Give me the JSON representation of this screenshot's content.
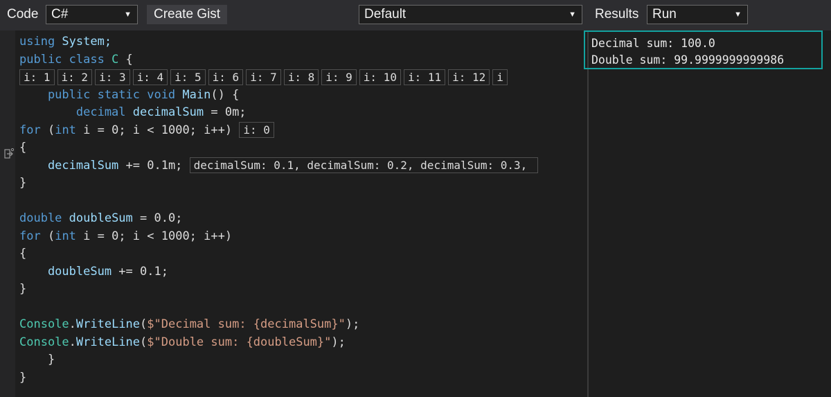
{
  "toolbar": {
    "code_label": "Code",
    "language": "C#",
    "create_gist": "Create Gist",
    "theme": "Default",
    "results_label": "Results",
    "run_mode": "Run"
  },
  "code_lines": [
    [
      {
        "t": "using ",
        "c": "kw"
      },
      {
        "t": "System;",
        "c": "id"
      }
    ],
    [
      {
        "t": "public class ",
        "c": "kw"
      },
      {
        "t": "C",
        "c": "ty"
      },
      {
        "t": " {",
        "c": "pl"
      }
    ],
    [
      {
        "b": "i: 1"
      },
      {
        "b": "i: 2"
      },
      {
        "b": "i: 3"
      },
      {
        "b": "i: 4"
      },
      {
        "b": "i: 5"
      },
      {
        "b": "i: 6"
      },
      {
        "b": "i: 7"
      },
      {
        "b": "i: 8"
      },
      {
        "b": "i: 9"
      },
      {
        "b": "i: 10"
      },
      {
        "b": "i: 11"
      },
      {
        "b": "i: 12"
      },
      {
        "b": "i"
      }
    ],
    [
      {
        "t": "    public static void ",
        "c": "kw"
      },
      {
        "t": "Main",
        "c": "id"
      },
      {
        "t": "() {",
        "c": "pl"
      }
    ],
    [
      {
        "t": "        decimal ",
        "c": "kw"
      },
      {
        "t": "decimalSum",
        "c": "id"
      },
      {
        "t": " = 0m;",
        "c": "pl"
      }
    ],
    [
      {
        "t": "for ",
        "c": "kw"
      },
      {
        "t": "(",
        "c": "pl"
      },
      {
        "t": "int",
        "c": "kw"
      },
      {
        "t": " i = 0; i < 1000; i++) ",
        "c": "pl"
      },
      {
        "b": "i: 0"
      }
    ],
    [
      {
        "t": "{",
        "c": "pl"
      }
    ],
    [
      {
        "t": "    decimalSum",
        "c": "id"
      },
      {
        "t": " += 0.1m; ",
        "c": "pl"
      },
      {
        "b": "decimalSum: 0.1, decimalSum: 0.2, decimalSum: 0.3, "
      }
    ],
    [
      {
        "t": "}",
        "c": "pl"
      }
    ],
    [
      {
        "t": "",
        "c": "pl"
      }
    ],
    [
      {
        "t": "double ",
        "c": "kw"
      },
      {
        "t": "doubleSum",
        "c": "id"
      },
      {
        "t": " = 0.0;",
        "c": "pl"
      }
    ],
    [
      {
        "t": "for ",
        "c": "kw"
      },
      {
        "t": "(",
        "c": "pl"
      },
      {
        "t": "int",
        "c": "kw"
      },
      {
        "t": " i = 0; i < 1000; i++)",
        "c": "pl"
      }
    ],
    [
      {
        "t": "{",
        "c": "pl"
      }
    ],
    [
      {
        "t": "    doubleSum",
        "c": "id"
      },
      {
        "t": " += 0.1;",
        "c": "pl"
      }
    ],
    [
      {
        "t": "}",
        "c": "pl"
      }
    ],
    [
      {
        "t": "",
        "c": "pl"
      }
    ],
    [
      {
        "t": "Console",
        "c": "ty"
      },
      {
        "t": ".",
        "c": "pl"
      },
      {
        "t": "WriteLine",
        "c": "id"
      },
      {
        "t": "(",
        "c": "pl"
      },
      {
        "t": "$\"Decimal sum: {decimalSum}\"",
        "c": "st"
      },
      {
        "t": ");",
        "c": "pl"
      }
    ],
    [
      {
        "t": "Console",
        "c": "ty"
      },
      {
        "t": ".",
        "c": "pl"
      },
      {
        "t": "WriteLine",
        "c": "id"
      },
      {
        "t": "(",
        "c": "pl"
      },
      {
        "t": "$\"Double sum: {doubleSum}\"",
        "c": "st"
      },
      {
        "t": ");",
        "c": "pl"
      }
    ],
    [
      {
        "t": "    }",
        "c": "pl"
      }
    ],
    [
      {
        "t": "}",
        "c": "pl"
      }
    ]
  ],
  "results": {
    "output": [
      "Decimal sum: 100.0",
      "Double sum: 99.9999999999986"
    ]
  },
  "gutter": {
    "icon": "step-arrow-icon"
  },
  "colors": {
    "keyword": "#569cd6",
    "type": "#4ec9b0",
    "identifier": "#9cdcfe",
    "string": "#d69d85",
    "output_border": "#13a3a0"
  }
}
